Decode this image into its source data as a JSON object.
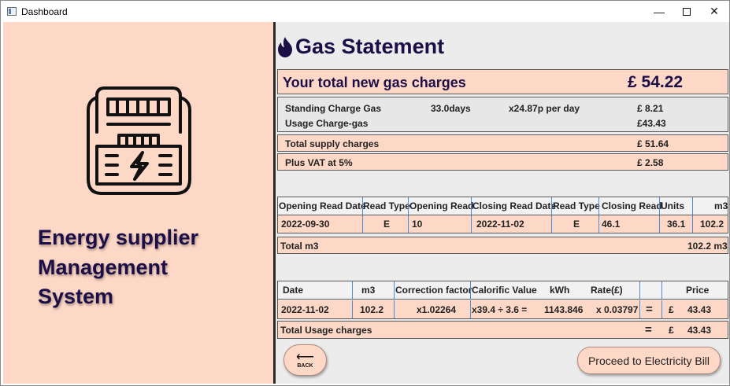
{
  "window": {
    "title": "Dashboard"
  },
  "brand": {
    "line1": "Energy supplier",
    "line2": "Management",
    "line3": "System"
  },
  "statement": {
    "title": "Gas Statement",
    "total_label": "Your total new gas charges",
    "total_value": "£ 54.22",
    "standing": {
      "label": "Standing Charge Gas",
      "days": "33.0days",
      "rate": "x24.87p per day",
      "amount": "£ 8.21"
    },
    "usage": {
      "label": "Usage Charge-gas",
      "amount": "£43.43"
    },
    "supply": {
      "label": "Total supply charges",
      "amount": "£ 51.64"
    },
    "vat": {
      "label": "Plus VAT at 5%",
      "amount": "£ 2.58"
    }
  },
  "reads_table": {
    "headers": [
      "Opening Read Date",
      "Read Type",
      "Opening Read",
      "Closing Read Date",
      "Read Type",
      "Closing Read",
      "Units",
      "m3"
    ],
    "row": [
      "2022-09-30",
      "E",
      "10",
      "2022-11-02",
      "E",
      "46.1",
      "36.1",
      "102.2"
    ],
    "total_label": "Total m3",
    "total_value": "102.2 m3"
  },
  "usage_table": {
    "headers": [
      "Date",
      "m3",
      "Correction factor",
      "Calorific Value",
      "kWh",
      "Rate(£)",
      "",
      "Price"
    ],
    "row": [
      "2022-11-02",
      "102.2",
      "x1.02264",
      "x39.4 ÷ 3.6  =",
      "1143.846",
      "x 0.03797",
      "=",
      "£",
      "43.43"
    ],
    "total_label": "Total Usage charges",
    "total_eq": "=",
    "total_currency": "£",
    "total_value": "43.43"
  },
  "buttons": {
    "back": "BACK",
    "proceed": "Proceed to Electricity Bill"
  },
  "colors": {
    "panel": "#fed8c7",
    "brand_text": "#1c0f47",
    "divider": "#2a2a2a"
  },
  "icons": {
    "app": "app-window-icon",
    "meter": "gas-meter-icon",
    "flame": "flame-icon",
    "back": "arrow-left-icon"
  }
}
